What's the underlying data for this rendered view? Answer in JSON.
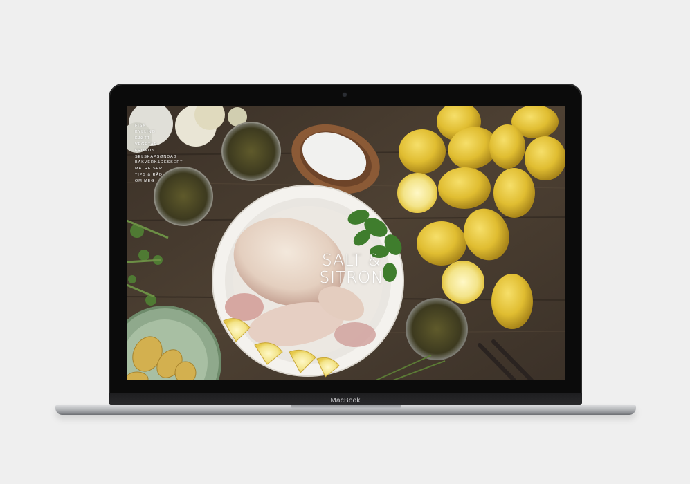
{
  "laptop": {
    "brand_label": "MacBook"
  },
  "site": {
    "nav": [
      "FISK",
      "KYLLING",
      "KJØTT",
      "VEGETAR",
      "FROKOST",
      "SELSKAPSØNDAG",
      "BAKVERK&DESSERT",
      "MATREISER",
      "TIPS & RÅD",
      "OM MEG"
    ],
    "title_line1": "SALT &",
    "title_line2": "SITRON"
  },
  "colors": {
    "background": "#efefef",
    "bezel": "#0b0b0b",
    "wood": "#4a3b2e",
    "lemon": "#e3c23a"
  }
}
